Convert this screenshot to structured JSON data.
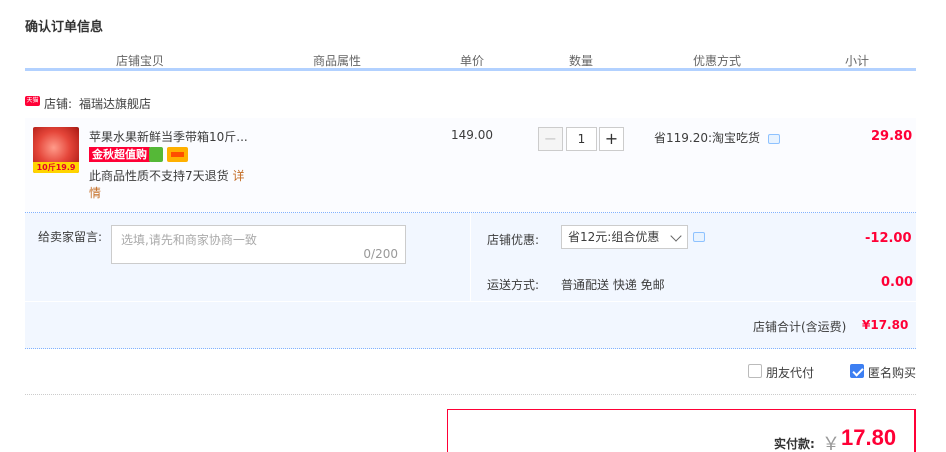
{
  "page": {
    "title": "确认订单信息"
  },
  "table_header": [
    "店铺宝贝",
    "商品属性",
    "单价",
    "数量",
    "优惠方式",
    "小计"
  ],
  "shop": {
    "icon_label": "天猫",
    "prefix": "店铺:",
    "name": "福瑞达旗舰店"
  },
  "item": {
    "title": "苹果水果新鲜当季带箱10斤...",
    "thumb_tag": "10斤19.9",
    "badge": "金秋超值购",
    "notice": "此商品性质不支持7天退货",
    "notice_link": "详情",
    "price": "149.00",
    "quantity": "1",
    "minus": "−",
    "plus": "+",
    "discount": "省119.20:淘宝吃货",
    "subtotal": "29.80"
  },
  "message": {
    "label": "给卖家留言:",
    "placeholder": "选填,请先和商家协商一致",
    "count": "0/200"
  },
  "shop_discount": {
    "label": "店铺优惠:",
    "selected": "省12元:组合优惠",
    "value": "-12.00"
  },
  "shipping": {
    "label": "运送方式:",
    "method": "普通配送 快递 免邮",
    "cost": "0.00"
  },
  "shop_total": {
    "label": "店铺合计(含运费)",
    "value": "¥17.80"
  },
  "options": {
    "friend_pay": "朋友代付",
    "anonymous": "匿名购买",
    "friend_pay_checked": false,
    "anonymous_checked": true
  },
  "payment": {
    "label": "实付款:",
    "currency": "￥",
    "amount": "17.80"
  },
  "colors": {
    "accent_red": "#ff0036",
    "header_line": "#b2d1ff",
    "checkbox_blue": "#3d7ff2"
  },
  "icons": [
    "tmall-shop-icon",
    "chat-icon",
    "chevron-down-icon",
    "check-icon"
  ]
}
